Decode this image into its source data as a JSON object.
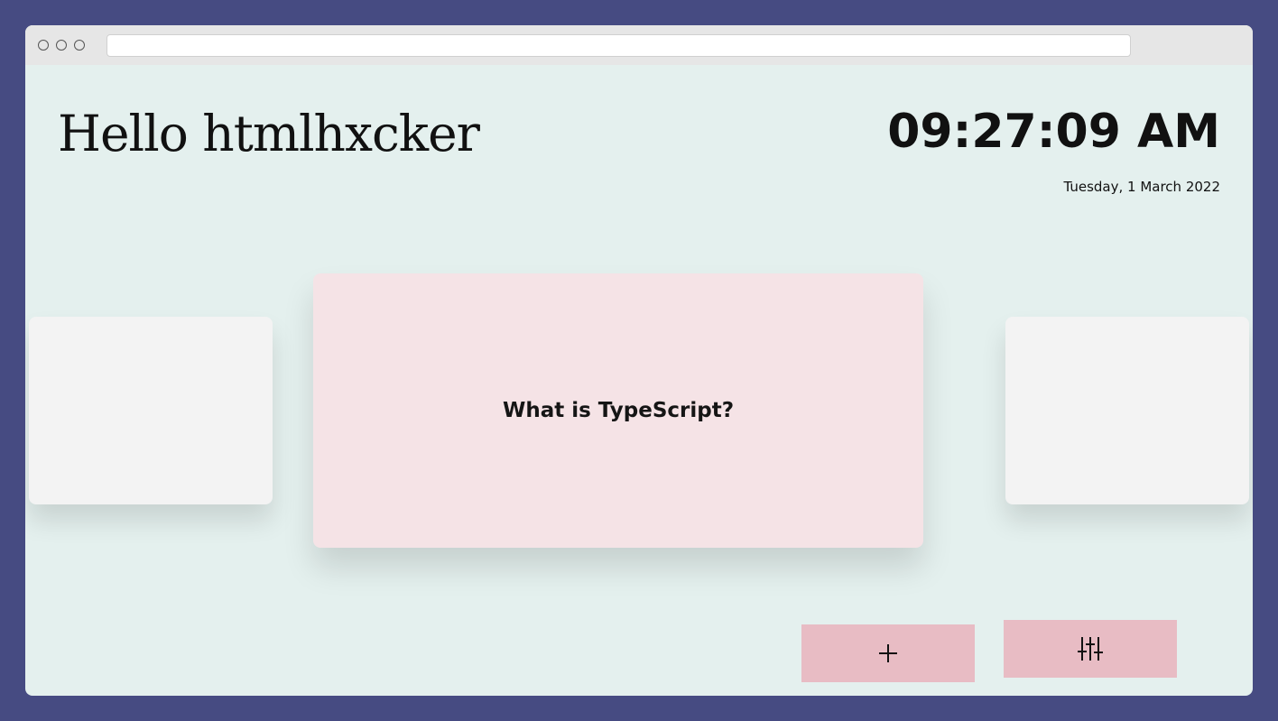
{
  "browser": {
    "url": ""
  },
  "header": {
    "greeting": "Hello htmlhxcker",
    "time": "09:27:09 AM",
    "date": "Tuesday, 1 March 2022"
  },
  "carousel": {
    "current_card": {
      "question": "What is TypeScript?"
    }
  },
  "actions": {
    "add_icon": "plus-icon",
    "settings_icon": "sliders-icon"
  },
  "colors": {
    "background": "#464b82",
    "page": "#e4f0ee",
    "main_card": "#f5e3e6",
    "side_card": "#f3f3f3",
    "button": "#e8bcc4"
  }
}
